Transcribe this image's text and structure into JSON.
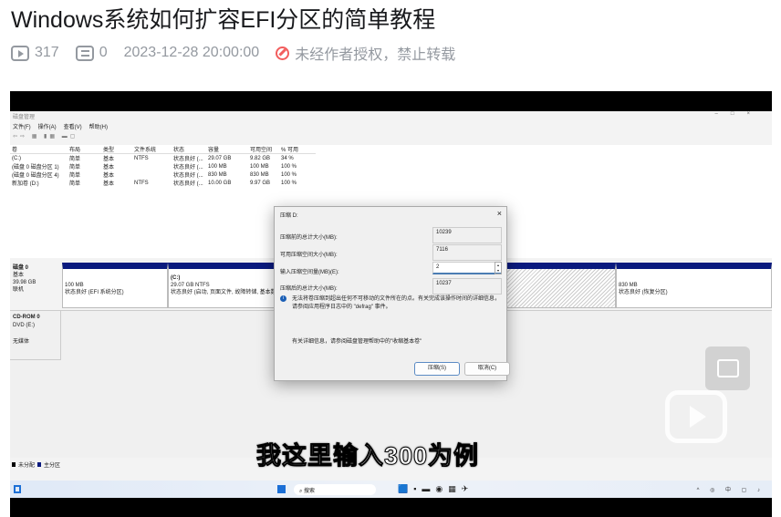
{
  "title": "Windows系统如何扩容EFI分区的简单教程",
  "meta": {
    "views": "317",
    "comments": "0",
    "date": "2023-12-28 20:00:00",
    "copyright": "未经作者授权，禁止转载"
  },
  "video": {
    "subtitle": "我这里输入300为例",
    "app": {
      "title": "磁盘管理",
      "menu": [
        "文件(F)",
        "操作(A)",
        "查看(V)",
        "帮助(H)"
      ],
      "columns": [
        "卷",
        "布局",
        "类型",
        "文件系统",
        "状态",
        "容量",
        "可用空间",
        "% 可用"
      ],
      "rows": [
        [
          "(C:)",
          "简单",
          "基本",
          "NTFS",
          "状态良好 (...",
          "29.07 GB",
          "9.82 GB",
          "34 %"
        ],
        [
          "(磁盘 0 磁盘分区 1)",
          "简单",
          "基本",
          "",
          "状态良好 (...",
          "100 MB",
          "100 MB",
          "100 %"
        ],
        [
          "(磁盘 0 磁盘分区 4)",
          "简单",
          "基本",
          "",
          "状态良好 (...",
          "830 MB",
          "830 MB",
          "100 %"
        ],
        [
          "新加卷 (D:)",
          "简单",
          "基本",
          "NTFS",
          "状态良好 (...",
          "10.00 GB",
          "9.97 GB",
          "100 %"
        ]
      ],
      "disk0": {
        "name": "磁盘 0",
        "type": "基本",
        "size": "39.98 GB",
        "status": "联机",
        "partitions": [
          {
            "l1": "",
            "l2": "100 MB",
            "l3": "状态良好 (EFI 系统分区)"
          },
          {
            "l1": "(C:)",
            "l2": "29.07 GB NTFS",
            "l3": "状态良好 (启动, 页面文件, 故障转储, 基本数"
          },
          {
            "l1": "",
            "l2": "830 MB",
            "l3": "状态良好 (恢复分区)"
          }
        ]
      },
      "cdrom": {
        "name": "CD-ROM 0",
        "type": "DVD (E:)",
        "status": "无媒体"
      },
      "legend": [
        "未分配",
        "主分区"
      ],
      "accent": "#0a1a7e"
    },
    "dialog": {
      "title": "压缩 D:",
      "labels": [
        "压缩前的总计大小(MB):",
        "可用压缩空间大小(MB):",
        "输入压缩空间量(MB)(E):",
        "压缩后的总计大小(MB):"
      ],
      "values": [
        "10239",
        "7116",
        "2",
        "10237"
      ],
      "info": "无法将卷压缩到超出任何不可移动的文件所在的点。有关完成该操作时间的详细信息，请参阅应用程序日志中的 \"defrag\" 事件。",
      "help": "有关详细信息，请参阅磁盘管理帮助中的\"收缩基本卷\"",
      "ok": "压缩(S)",
      "cancel": "取消(C)"
    },
    "taskbar": {
      "search": "搜索",
      "tray": [
        "^",
        "中"
      ]
    }
  }
}
